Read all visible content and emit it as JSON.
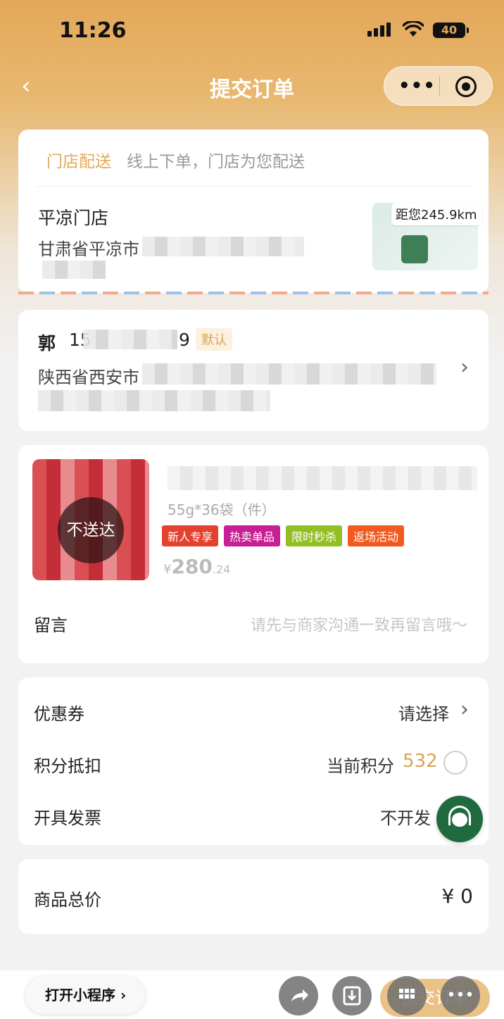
{
  "status_bar": {
    "time": "11:26",
    "battery": "40"
  },
  "nav": {
    "title": "提交订单",
    "more_glyph": "•••"
  },
  "store_card": {
    "mode": "门店配送",
    "mode_desc": "线上下单，门店为您配送",
    "store_name": "平凉门店",
    "address_prefix": "甘肃省平凉市",
    "distance": "距您245.9km"
  },
  "address_card": {
    "name": "郭",
    "phone_prefix": "15",
    "phone_suffix": "9",
    "default_tag": "默认",
    "address_prefix": "陕西省西安市"
  },
  "goods": {
    "not_delivered": "不送达",
    "spec": "55g*36袋（件）",
    "tags": [
      {
        "label": "新人专享",
        "color": "#e5412f"
      },
      {
        "label": "热卖单品",
        "color": "#c81f94"
      },
      {
        "label": "限时秒杀",
        "color": "#92c022"
      },
      {
        "label": "返场活动",
        "color": "#f25a1f"
      }
    ],
    "price_currency": "¥",
    "price_int": "280",
    "price_dec": ".24",
    "message_label": "留言",
    "message_placeholder": "请先与商家沟通一致再留言哦～"
  },
  "options": {
    "coupon_label": "优惠券",
    "coupon_value": "请选择",
    "points_label": "积分抵扣",
    "points_prefix": "当前积分",
    "points_value": "532",
    "invoice_label": "开具发票",
    "invoice_value": "不开发"
  },
  "total": {
    "label": "商品总价",
    "value": "¥ 0"
  },
  "bottom": {
    "open_mini": "打开小程序",
    "submit_label": "提交订单",
    "more_glyph": "•••"
  }
}
